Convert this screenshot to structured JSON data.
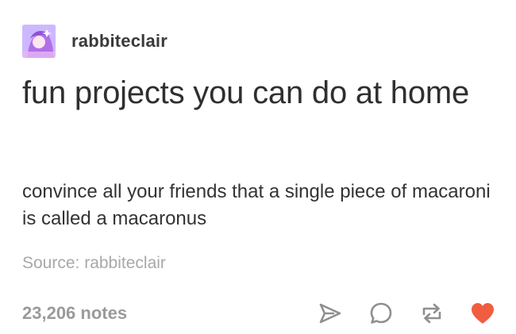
{
  "post": {
    "username": "rabbiteclair",
    "title": "fun projects you can do at home",
    "body": "convince all your friends that a single piece of macaroni is called a macaronus",
    "source_label": "Source: rabbiteclair",
    "notes": "23,206 notes"
  },
  "icons": {
    "share": "share-icon",
    "reply": "reply-icon",
    "reblog": "reblog-icon",
    "like": "heart-icon"
  },
  "colors": {
    "like": "#f05d40",
    "icon_gray": "#9a9a9a"
  }
}
